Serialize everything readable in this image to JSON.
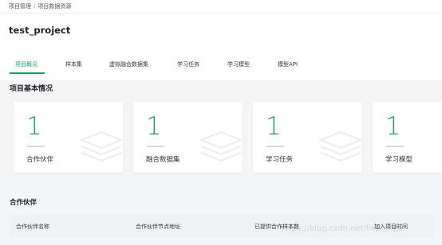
{
  "breadcrumb": {
    "items": [
      "项目管理",
      "项目数据资源"
    ],
    "separator": "/"
  },
  "project": {
    "title": "test_project"
  },
  "tabs": [
    {
      "label": "项目概况",
      "active": true
    },
    {
      "label": "样本集",
      "active": false
    },
    {
      "label": "虚拟融合数据集",
      "active": false
    },
    {
      "label": "学习任务",
      "active": false
    },
    {
      "label": "学习模型",
      "active": false
    },
    {
      "label": "模型API",
      "active": false
    }
  ],
  "overview": {
    "title": "项目基本情况",
    "cards": [
      {
        "value": "1",
        "label": "合作伙伴"
      },
      {
        "value": "1",
        "label": "融合数据集"
      },
      {
        "value": "1",
        "label": "学习任务"
      },
      {
        "value": "1",
        "label": "学习模型"
      }
    ]
  },
  "partners": {
    "title": "合作伙伴",
    "columns": [
      "合作伙伴名称",
      "合作伙伴节点地址",
      "已提供合作样本数",
      "加入项目时间"
    ]
  },
  "watermark": {
    "text": "https://blog.csdn.net/hellompc"
  },
  "colors": {
    "accent": "#18a058",
    "number": "#1e9b6f",
    "background": "#f4f5f6"
  }
}
